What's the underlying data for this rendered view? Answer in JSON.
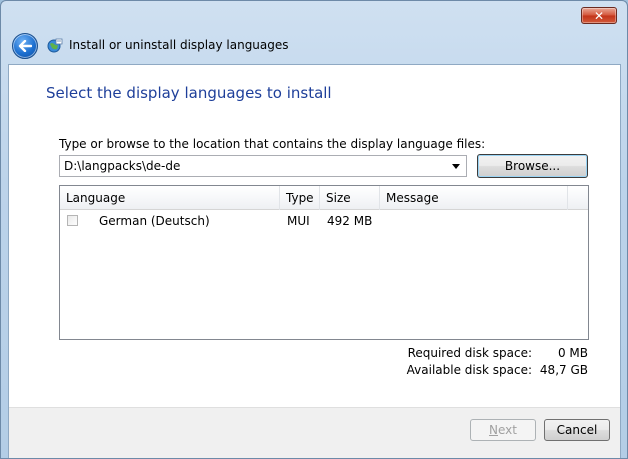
{
  "window": {
    "title": "Install or uninstall display languages",
    "close_label": "✕"
  },
  "page": {
    "heading": "Select the display languages to install",
    "prompt": "Type or browse to the location that contains the display language files:",
    "path_value": "D:\\langpacks\\de-de",
    "browse_label": "Browse..."
  },
  "list": {
    "columns": [
      "Language",
      "Type",
      "Size",
      "Message"
    ],
    "rows": [
      {
        "language": "German (Deutsch)",
        "type": "MUI",
        "size": "492 MB",
        "message": "",
        "checked": false
      }
    ]
  },
  "disk": {
    "required_label": "Required disk space:",
    "required_value": "0 MB",
    "available_label": "Available disk space:",
    "available_value": "48,7 GB"
  },
  "footer": {
    "next_label": "Next",
    "next_mnemonic": "N",
    "next_rest": "ext",
    "next_enabled": false,
    "cancel_label": "Cancel"
  },
  "icons": {
    "back": "back-arrow-icon",
    "title": "globe-icon",
    "dropdown": "chevron-down-icon"
  }
}
